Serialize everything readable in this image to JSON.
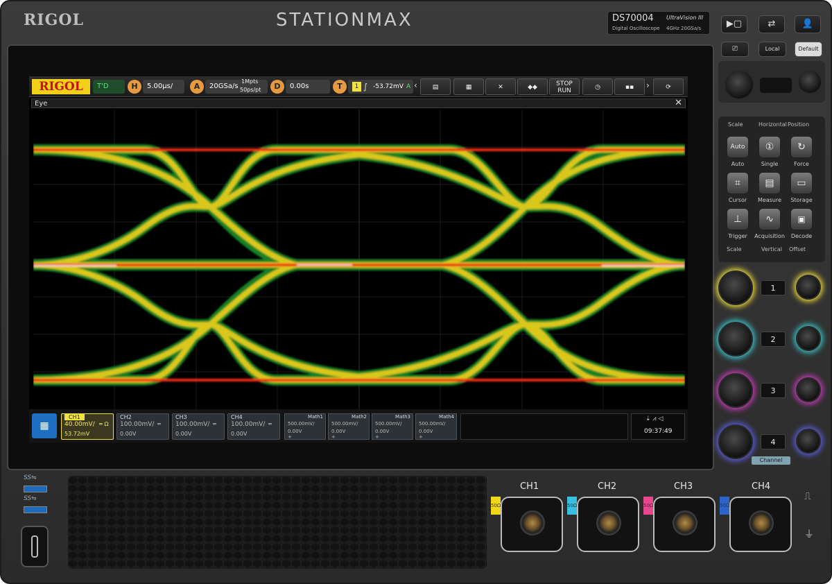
{
  "device": {
    "brand": "RIGOL",
    "series": "STATIONMAX",
    "model": "DS70004",
    "model_sub": "Digital Oscilloscope",
    "ultravision": "UltraVision III",
    "specs": "4GHz 20GSa/s"
  },
  "top_buttons": [
    "▶▢",
    "⇄",
    "👤"
  ],
  "front_buttons": {
    "local": "Local",
    "default": "Default"
  },
  "status_bar": {
    "logo": "RIGOL",
    "trigger_state": "T'D",
    "horizontal_badge": "H",
    "timebase": "5.00μs/",
    "acq_badge": "A",
    "sample_rate": "20GSa/s",
    "memory_depth": "1Mpts",
    "sample_interval": "50ps/pt",
    "delay_badge": "D",
    "delay": "0.00s",
    "trigger_badge": "T",
    "trigger_channel": "1",
    "trigger_level": "-53.72mV",
    "trigger_suffix": "A",
    "toolbar": {
      "stop_run_top": "STOP",
      "stop_run_bottom": "RUN"
    }
  },
  "window": {
    "title": "Eye",
    "close": "✕"
  },
  "channels": [
    {
      "tab": "CH1",
      "scale": "40.00mV/",
      "coupling": "═ Ω",
      "offset": "53.72mV"
    },
    {
      "tab": "CH2",
      "scale": "100.00mV/",
      "coupling": "═",
      "offset": "0.00V"
    },
    {
      "tab": "CH3",
      "scale": "100.00mV/",
      "coupling": "═",
      "offset": "0.00V"
    },
    {
      "tab": "CH4",
      "scale": "100.00mV/",
      "coupling": "═",
      "offset": "0.00V"
    }
  ],
  "math": [
    {
      "tab": "Math1",
      "scale": "500.00mV/",
      "offset": "0.00V",
      "extra": "+"
    },
    {
      "tab": "Math2",
      "scale": "500.00mV/",
      "offset": "0.00V",
      "extra": "+"
    },
    {
      "tab": "Math3",
      "scale": "500.00mV/",
      "offset": "0.00V",
      "extra": "+"
    },
    {
      "tab": "Math4",
      "scale": "500.00mV/",
      "offset": "0.00V",
      "extra": "+"
    }
  ],
  "clock": "09:37:49",
  "right_panel": {
    "horizontal": {
      "scale": "Scale",
      "title": "Horizontal",
      "position": "Position"
    },
    "buttons": [
      "Auto",
      "Single",
      "Force",
      "Cursor",
      "Measure",
      "Storage",
      "Trigger",
      "Acquisition",
      "Decode"
    ],
    "auto_face": "Auto",
    "vertical": {
      "scale": "Scale",
      "title": "Vertical",
      "offset": "Offset"
    },
    "channel_numbers": [
      "1",
      "2",
      "3",
      "4"
    ],
    "channel_label": "Channel"
  },
  "inputs": {
    "labels": [
      "CH1",
      "CH2",
      "CH3",
      "CH4"
    ],
    "ohm": [
      "50Ω",
      "50Ω",
      "50Ω",
      "50Ω"
    ],
    "colors": [
      "#f2d61b",
      "#38bfe0",
      "#e8468f",
      "#2c64c8"
    ]
  },
  "usb": [
    "SS⇋",
    "SS⇋"
  ],
  "colors": {
    "logo_bg": "#f3d11a",
    "ch1": "#f0e341",
    "ch2": "#39c0c8",
    "ch3": "#c53ab8",
    "ch4": "#5b5bd8"
  }
}
